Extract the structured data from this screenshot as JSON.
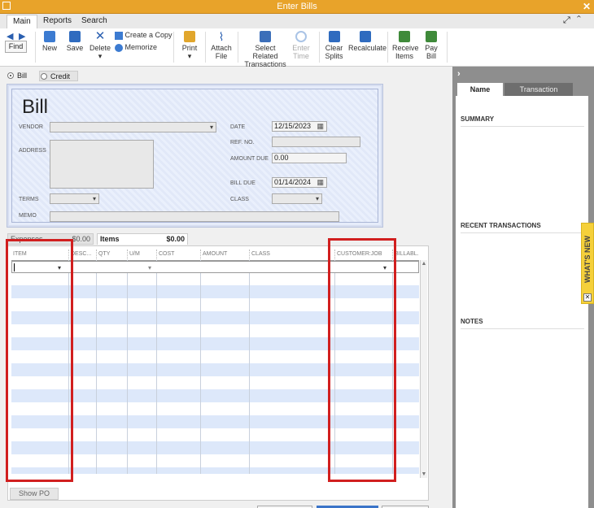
{
  "window": {
    "title": "Enter Bills"
  },
  "tabs": [
    "Main",
    "Reports",
    "Search"
  ],
  "toolbar": {
    "find": "Find",
    "new": "New",
    "save": "Save",
    "delete": "Delete",
    "create_copy": "Create a Copy",
    "memorize": "Memorize",
    "print": "Print",
    "attach_file": [
      "Attach",
      "File"
    ],
    "select_related": [
      "Select Related",
      "Transactions"
    ],
    "enter_time": [
      "Enter",
      "Time"
    ],
    "clear_splits": [
      "Clear",
      "Splits"
    ],
    "recalculate": "Recalculate",
    "receive_items": [
      "Receive",
      "Items"
    ],
    "pay_bill": [
      "Pay",
      "Bill"
    ]
  },
  "mode": {
    "bill": "Bill",
    "credit": "Credit",
    "selected": "Bill"
  },
  "form": {
    "title": "Bill",
    "vendor_label": "VENDOR",
    "address_label": "ADDRESS",
    "terms_label": "TERMS",
    "memo_label": "MEMO",
    "date_label": "DATE",
    "date": "12/15/2023",
    "ref_label": "REF. NO.",
    "amount_due_label": "AMOUNT DUE",
    "amount_due": "0.00",
    "bill_due_label": "BILL DUE",
    "bill_due": "01/14/2024",
    "class_label": "CLASS"
  },
  "subtabs": {
    "expenses": "Expenses",
    "expenses_amount": "$0.00",
    "items": "Items",
    "items_amount": "$0.00"
  },
  "grid": {
    "columns": [
      "ITEM",
      "DESC...",
      "QTY",
      "U/M",
      "COST",
      "AMOUNT",
      "CLASS",
      "CUSTOMER:JOB",
      "BILLABL..."
    ]
  },
  "show_po": "Show PO",
  "panel": {
    "tabs": [
      "Name",
      "Transaction"
    ],
    "sections": [
      "SUMMARY",
      "RECENT TRANSACTIONS",
      "NOTES"
    ],
    "whats_new": "WHAT'S NEW"
  },
  "colors": {
    "title_bar": "#e8a32a",
    "highlight": "#d11f1f"
  }
}
